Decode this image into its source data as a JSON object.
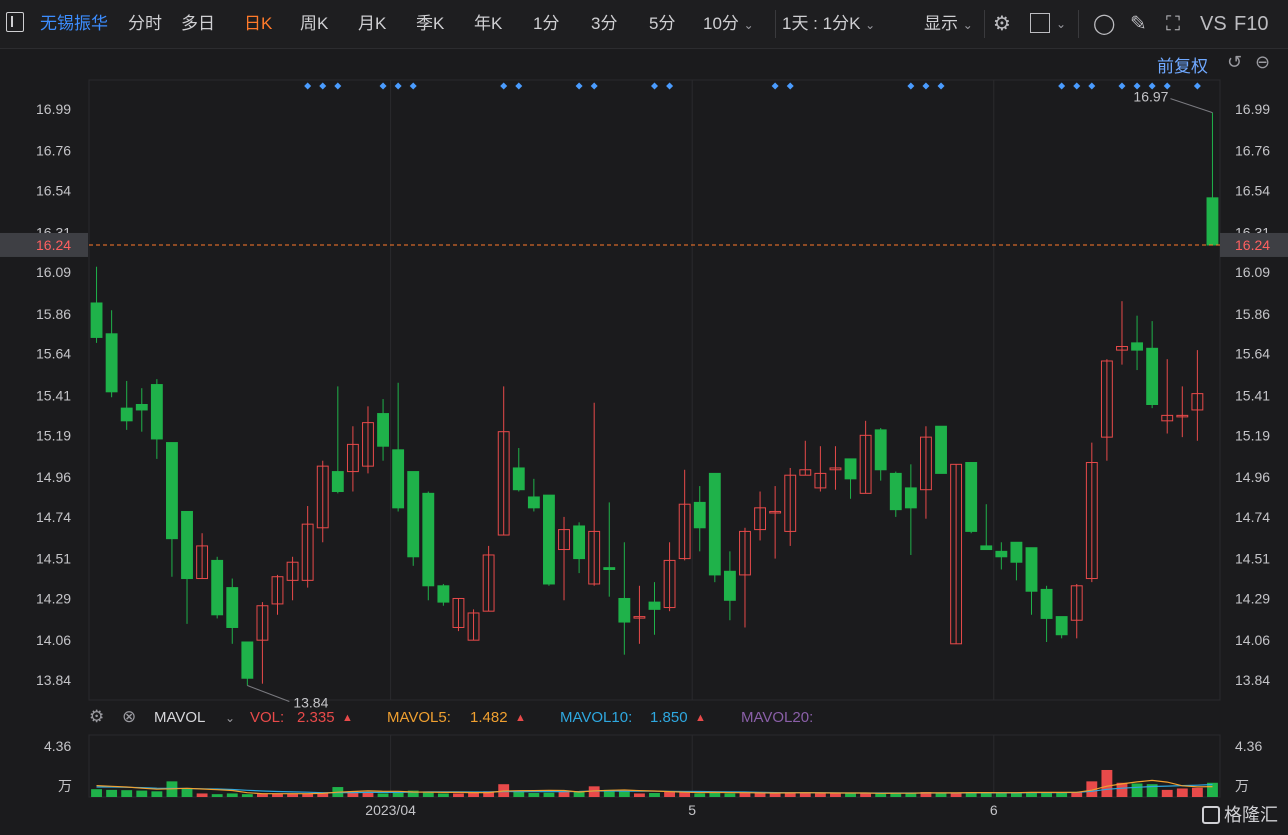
{
  "toolbar": {
    "stock_name": "无锡振华",
    "periods": [
      "分时",
      "多日",
      "日K",
      "周K",
      "月K",
      "季K",
      "年K",
      "1分",
      "3分",
      "5分",
      "10分"
    ],
    "active_period": "日K",
    "interval": "1天 : 1分K",
    "display": "显示",
    "vs": "VS",
    "f10": "F10"
  },
  "adjust": {
    "label": "前复权"
  },
  "price": {
    "current": "16.24",
    "high_label": "16.97",
    "low_label": "13.84"
  },
  "indicator": {
    "name": "MAVOL",
    "vol_label": "VOL:",
    "vol_value": "2.335",
    "mavol5_label": "MAVOL5:",
    "mavol5_value": "1.482",
    "mavol10_label": "MAVOL10:",
    "mavol10_value": "1.850",
    "mavol20_label": "MAVOL20:",
    "max_label": "4.36",
    "unit_label": "万"
  },
  "watermark": "格隆汇",
  "colors": {
    "up": "#e84a4a",
    "down": "#1fb24a",
    "accent": "#ff7a2a",
    "link": "#3c8dff",
    "mavol5": "#f0a030",
    "mavol10": "#2ea8e0",
    "mavol20": "#8a5fa8"
  },
  "chart_data": {
    "type": "candlestick",
    "ylim": [
      13.73,
      17.15
    ],
    "y_ticks": [
      "16.99",
      "16.76",
      "16.54",
      "16.31",
      "16.09",
      "15.86",
      "15.64",
      "15.41",
      "15.19",
      "14.96",
      "14.74",
      "14.51",
      "14.29",
      "14.06",
      "13.84"
    ],
    "x_ticks": [
      {
        "label": "2023/04",
        "index": 20
      },
      {
        "label": "5",
        "index": 40
      },
      {
        "label": "6",
        "index": 60
      }
    ],
    "candles": [
      {
        "o": 15.92,
        "c": 15.73,
        "h": 16.12,
        "l": 15.7
      },
      {
        "o": 15.75,
        "c": 15.43,
        "h": 15.88,
        "l": 15.4
      },
      {
        "o": 15.34,
        "c": 15.27,
        "h": 15.49,
        "l": 15.22
      },
      {
        "o": 15.36,
        "c": 15.33,
        "h": 15.45,
        "l": 15.21
      },
      {
        "o": 15.47,
        "c": 15.17,
        "h": 15.5,
        "l": 15.06
      },
      {
        "o": 15.15,
        "c": 14.62,
        "h": 15.15,
        "l": 14.41
      },
      {
        "o": 14.77,
        "c": 14.4,
        "h": 14.77,
        "l": 14.15
      },
      {
        "o": 14.4,
        "c": 14.58,
        "h": 14.65,
        "l": 14.4
      },
      {
        "o": 14.5,
        "c": 14.2,
        "h": 14.52,
        "l": 14.18
      },
      {
        "o": 14.35,
        "c": 14.13,
        "h": 14.4,
        "l": 14.04
      },
      {
        "o": 14.05,
        "c": 13.85,
        "h": 14.05,
        "l": 13.81
      },
      {
        "o": 14.06,
        "c": 14.25,
        "h": 14.27,
        "l": 13.82
      },
      {
        "o": 14.26,
        "c": 14.41,
        "h": 14.42,
        "l": 14.2
      },
      {
        "o": 14.39,
        "c": 14.49,
        "h": 14.52,
        "l": 14.28
      },
      {
        "o": 14.39,
        "c": 14.7,
        "h": 14.8,
        "l": 14.35
      },
      {
        "o": 14.68,
        "c": 15.02,
        "h": 15.05,
        "l": 14.6
      },
      {
        "o": 14.99,
        "c": 14.88,
        "h": 15.46,
        "l": 14.87
      },
      {
        "o": 14.99,
        "c": 15.14,
        "h": 15.24,
        "l": 14.88
      },
      {
        "o": 15.02,
        "c": 15.26,
        "h": 15.35,
        "l": 14.98
      },
      {
        "o": 15.31,
        "c": 15.13,
        "h": 15.39,
        "l": 15.05
      },
      {
        "o": 15.11,
        "c": 14.79,
        "h": 15.48,
        "l": 14.77
      },
      {
        "o": 14.99,
        "c": 14.52,
        "h": 14.99,
        "l": 14.47
      },
      {
        "o": 14.87,
        "c": 14.36,
        "h": 14.88,
        "l": 14.28
      },
      {
        "o": 14.36,
        "c": 14.27,
        "h": 14.37,
        "l": 14.25
      },
      {
        "o": 14.13,
        "c": 14.29,
        "h": 14.29,
        "l": 14.11
      },
      {
        "o": 14.06,
        "c": 14.21,
        "h": 14.23,
        "l": 14.06
      },
      {
        "o": 14.22,
        "c": 14.53,
        "h": 14.58,
        "l": 14.22
      },
      {
        "o": 14.64,
        "c": 15.21,
        "h": 15.46,
        "l": 14.64
      },
      {
        "o": 15.01,
        "c": 14.89,
        "h": 15.12,
        "l": 14.88
      },
      {
        "o": 14.85,
        "c": 14.79,
        "h": 14.95,
        "l": 14.77
      },
      {
        "o": 14.86,
        "c": 14.37,
        "h": 14.86,
        "l": 14.36
      },
      {
        "o": 14.56,
        "c": 14.67,
        "h": 14.74,
        "l": 14.28
      },
      {
        "o": 14.69,
        "c": 14.51,
        "h": 14.71,
        "l": 14.43
      },
      {
        "o": 14.37,
        "c": 14.66,
        "h": 15.37,
        "l": 14.36
      },
      {
        "o": 14.46,
        "c": 14.45,
        "h": 14.82,
        "l": 14.3
      },
      {
        "o": 14.29,
        "c": 14.16,
        "h": 14.6,
        "l": 13.98
      },
      {
        "o": 14.19,
        "c": 14.19,
        "h": 14.36,
        "l": 14.04
      },
      {
        "o": 14.27,
        "c": 14.23,
        "h": 14.38,
        "l": 14.09
      },
      {
        "o": 14.24,
        "c": 14.5,
        "h": 14.6,
        "l": 14.22
      },
      {
        "o": 14.51,
        "c": 14.81,
        "h": 15.0,
        "l": 14.5
      },
      {
        "o": 14.82,
        "c": 14.68,
        "h": 14.91,
        "l": 14.55
      },
      {
        "o": 14.98,
        "c": 14.42,
        "h": 14.98,
        "l": 14.38
      },
      {
        "o": 14.44,
        "c": 14.28,
        "h": 14.55,
        "l": 14.17
      },
      {
        "o": 14.42,
        "c": 14.66,
        "h": 14.68,
        "l": 14.13
      },
      {
        "o": 14.67,
        "c": 14.79,
        "h": 14.88,
        "l": 14.61
      },
      {
        "o": 14.77,
        "c": 14.77,
        "h": 14.91,
        "l": 14.51
      },
      {
        "o": 14.66,
        "c": 14.97,
        "h": 15.01,
        "l": 14.58
      },
      {
        "o": 14.97,
        "c": 15.0,
        "h": 15.16,
        "l": 14.97
      },
      {
        "o": 14.9,
        "c": 14.98,
        "h": 15.13,
        "l": 14.88
      },
      {
        "o": 15.0,
        "c": 15.01,
        "h": 15.13,
        "l": 14.89
      },
      {
        "o": 15.06,
        "c": 14.95,
        "h": 15.06,
        "l": 14.84
      },
      {
        "o": 14.87,
        "c": 15.19,
        "h": 15.27,
        "l": 14.87
      },
      {
        "o": 15.22,
        "c": 15.0,
        "h": 15.23,
        "l": 14.94
      },
      {
        "o": 14.98,
        "c": 14.78,
        "h": 14.99,
        "l": 14.74
      },
      {
        "o": 14.9,
        "c": 14.79,
        "h": 15.03,
        "l": 14.53
      },
      {
        "o": 14.89,
        "c": 15.18,
        "h": 15.24,
        "l": 14.73
      },
      {
        "o": 15.24,
        "c": 14.98,
        "h": 15.24,
        "l": 14.98
      },
      {
        "o": 14.04,
        "c": 15.03,
        "h": 15.03,
        "l": 14.04
      },
      {
        "o": 15.04,
        "c": 14.66,
        "h": 15.04,
        "l": 14.65
      },
      {
        "o": 14.58,
        "c": 14.56,
        "h": 14.81,
        "l": 14.56
      },
      {
        "o": 14.55,
        "c": 14.52,
        "h": 14.6,
        "l": 14.45
      },
      {
        "o": 14.6,
        "c": 14.49,
        "h": 14.6,
        "l": 14.39
      },
      {
        "o": 14.57,
        "c": 14.33,
        "h": 14.57,
        "l": 14.2
      },
      {
        "o": 14.34,
        "c": 14.18,
        "h": 14.36,
        "l": 14.05
      },
      {
        "o": 14.19,
        "c": 14.09,
        "h": 14.19,
        "l": 14.07
      },
      {
        "o": 14.17,
        "c": 14.36,
        "h": 14.37,
        "l": 14.07
      },
      {
        "o": 14.4,
        "c": 15.04,
        "h": 15.15,
        "l": 14.38
      },
      {
        "o": 15.18,
        "c": 15.6,
        "h": 15.61,
        "l": 15.05
      },
      {
        "o": 15.66,
        "c": 15.68,
        "h": 15.93,
        "l": 15.58
      },
      {
        "o": 15.7,
        "c": 15.66,
        "h": 15.85,
        "l": 15.55
      },
      {
        "o": 15.67,
        "c": 15.36,
        "h": 15.82,
        "l": 15.34
      },
      {
        "o": 15.27,
        "c": 15.3,
        "h": 15.61,
        "l": 15.2
      },
      {
        "o": 15.3,
        "c": 15.3,
        "h": 15.46,
        "l": 15.18
      },
      {
        "o": 15.33,
        "c": 15.42,
        "h": 15.66,
        "l": 15.16
      },
      {
        "o": 16.5,
        "c": 16.24,
        "h": 16.97,
        "l": 16.24
      }
    ],
    "volume": {
      "ymax": 4.36,
      "values": [
        0.55,
        0.5,
        0.48,
        0.45,
        0.4,
        1.1,
        0.6,
        0.25,
        0.2,
        0.25,
        0.2,
        0.25,
        0.22,
        0.25,
        0.22,
        0.3,
        0.7,
        0.4,
        0.35,
        0.25,
        0.3,
        0.45,
        0.35,
        0.25,
        0.25,
        0.3,
        0.4,
        0.9,
        0.35,
        0.28,
        0.3,
        0.45,
        0.35,
        0.75,
        0.5,
        0.4,
        0.25,
        0.28,
        0.35,
        0.4,
        0.25,
        0.3,
        0.25,
        0.28,
        0.35,
        0.25,
        0.3,
        0.3,
        0.25,
        0.28,
        0.25,
        0.3,
        0.25,
        0.25,
        0.3,
        0.35,
        0.3,
        0.25,
        0.35,
        0.3,
        0.28,
        0.3,
        0.35,
        0.35,
        0.3,
        0.35,
        1.1,
        1.9,
        1.0,
        0.95,
        0.9,
        0.5,
        0.6,
        0.65,
        1.0
      ],
      "ma5": [
        0.8,
        0.75,
        0.7,
        0.62,
        0.55,
        0.58,
        0.61,
        0.56,
        0.51,
        0.46,
        0.3,
        0.23,
        0.23,
        0.23,
        0.23,
        0.25,
        0.34,
        0.39,
        0.43,
        0.4,
        0.4,
        0.35,
        0.34,
        0.32,
        0.32,
        0.31,
        0.31,
        0.42,
        0.44,
        0.45,
        0.47,
        0.46,
        0.35,
        0.43,
        0.47,
        0.49,
        0.45,
        0.42,
        0.38,
        0.34,
        0.31,
        0.32,
        0.31,
        0.3,
        0.29,
        0.28,
        0.29,
        0.3,
        0.29,
        0.28,
        0.28,
        0.28,
        0.26,
        0.27,
        0.27,
        0.29,
        0.29,
        0.29,
        0.31,
        0.31,
        0.3,
        0.3,
        0.32,
        0.32,
        0.32,
        0.33,
        0.48,
        0.76,
        0.92,
        1.06,
        1.17,
        1.05,
        0.79,
        0.72,
        0.73
      ],
      "ma10": [
        0.7,
        0.7,
        0.68,
        0.66,
        0.62,
        0.61,
        0.6,
        0.58,
        0.56,
        0.53,
        0.47,
        0.42,
        0.39,
        0.36,
        0.34,
        0.3,
        0.31,
        0.31,
        0.32,
        0.32,
        0.32,
        0.34,
        0.36,
        0.36,
        0.36,
        0.35,
        0.35,
        0.39,
        0.38,
        0.38,
        0.38,
        0.38,
        0.39,
        0.42,
        0.42,
        0.41,
        0.41,
        0.41,
        0.4,
        0.39,
        0.39,
        0.37,
        0.36,
        0.35,
        0.33,
        0.31,
        0.3,
        0.3,
        0.3,
        0.29,
        0.28,
        0.28,
        0.28,
        0.28,
        0.28,
        0.28,
        0.28,
        0.28,
        0.29,
        0.29,
        0.29,
        0.29,
        0.3,
        0.31,
        0.31,
        0.32,
        0.4,
        0.54,
        0.62,
        0.68,
        0.74,
        0.77,
        0.8,
        0.83,
        0.88
      ]
    },
    "marker_indices": [
      14,
      15,
      16,
      19,
      20,
      21,
      27,
      28,
      32,
      33,
      37,
      38,
      45,
      46,
      54,
      55,
      56,
      64,
      65,
      66,
      68,
      69,
      70,
      71,
      73
    ]
  }
}
